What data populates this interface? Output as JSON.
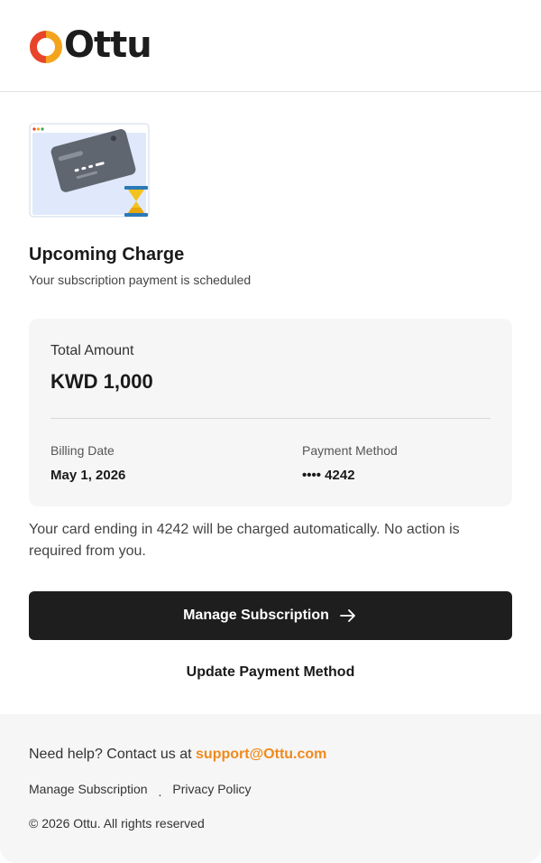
{
  "brand": {
    "name": "Ottu",
    "accent_color": "#f08a1c",
    "logo_colors": [
      "#f4a41c",
      "#e8442a"
    ]
  },
  "hero": {
    "title": "Upcoming Charge",
    "subtitle": "Your subscription payment is scheduled"
  },
  "summary": {
    "total_label": "Total Amount",
    "total_value": "KWD 1,000",
    "billing_date_label": "Billing Date",
    "billing_date_value": "May 1, 2026",
    "payment_method_label": "Payment Method",
    "payment_method_value": "•••• 4242"
  },
  "notice": "Your card ending in 4242 will be charged automatically. No action is required from you.",
  "actions": {
    "primary_label": "Manage Subscription",
    "secondary_label": "Update Payment Method"
  },
  "footer": {
    "help_text": "Need help? Contact us at",
    "help_email": "support@Ottu.com",
    "link_manage": "Manage Subscription",
    "link_separator": ".",
    "link_privacy": "Privacy Policy",
    "copyright": "© 2026 Ottu. All rights reserved"
  }
}
